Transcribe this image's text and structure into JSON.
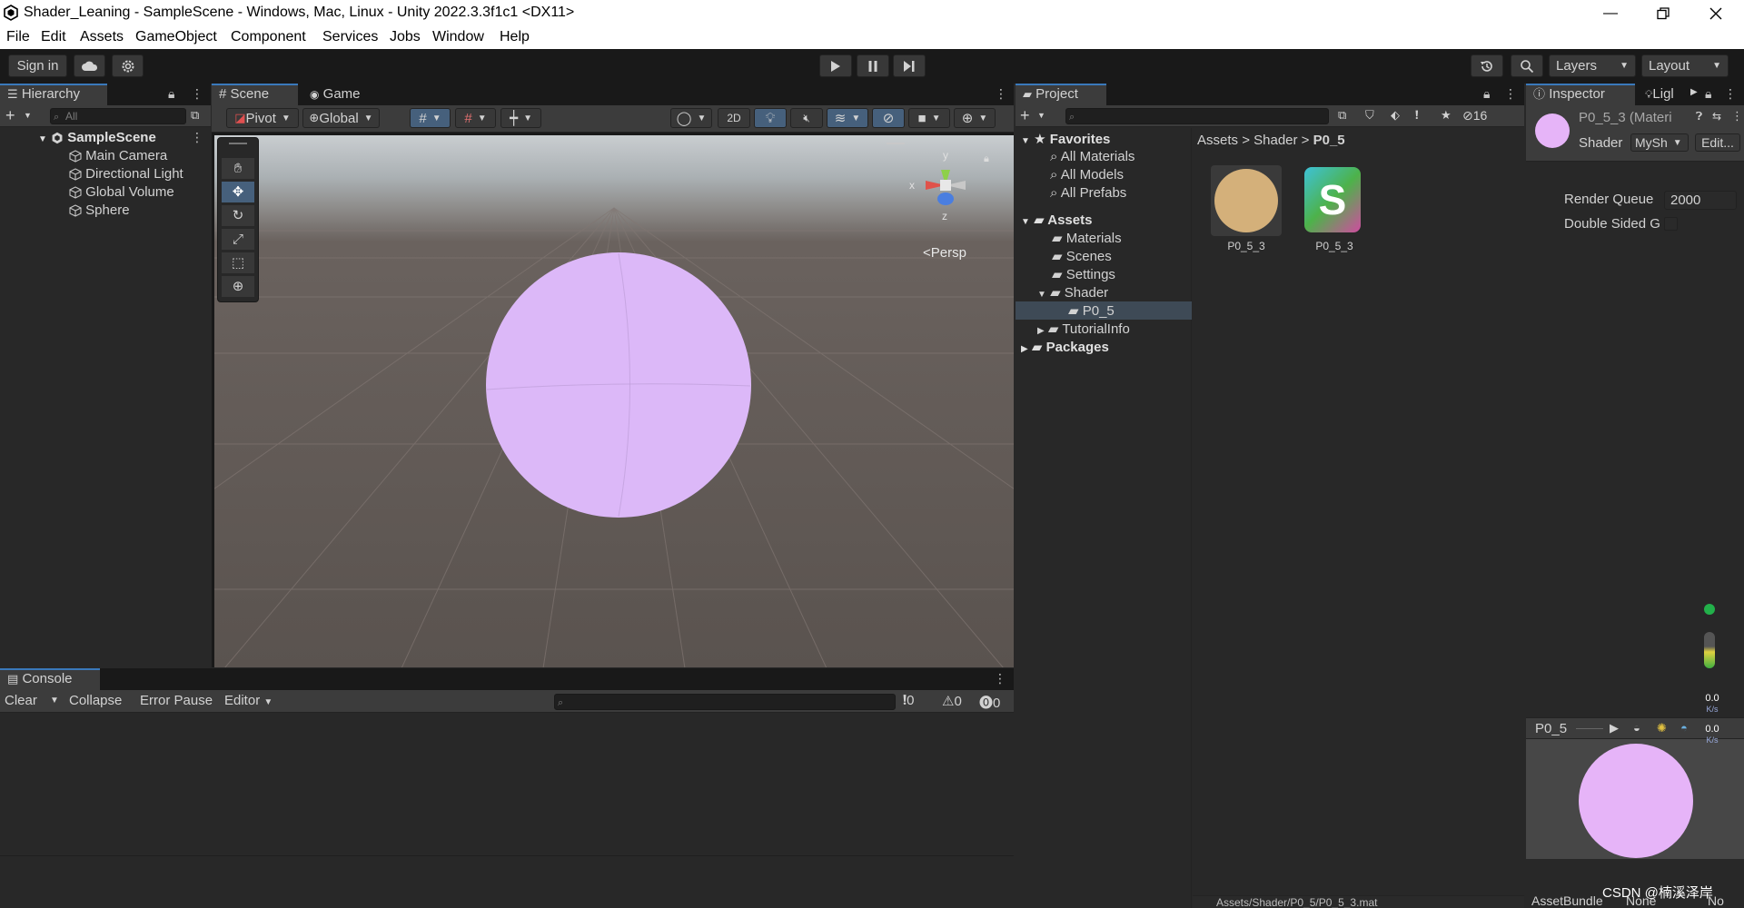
{
  "window": {
    "title": "Shader_Leaning - SampleScene - Windows, Mac, Linux - Unity 2022.3.3f1c1 <DX11>"
  },
  "menu": [
    "File",
    "Edit",
    "Assets",
    "GameObject",
    "Component",
    "Services",
    "Jobs",
    "Window",
    "Help"
  ],
  "toolbar": {
    "sign_in": "Sign in",
    "layers": "Layers",
    "layout": "Layout"
  },
  "hierarchy": {
    "tab": "Hierarchy",
    "search_placeholder": "All",
    "scene": "SampleScene",
    "items": [
      "Main Camera",
      "Directional Light",
      "Global Volume",
      "Sphere"
    ]
  },
  "scene_panel": {
    "tab_scene": "Scene",
    "tab_game": "Game",
    "pivot": "Pivot",
    "global": "Global",
    "mode_2d": "2D",
    "persp": "Persp",
    "axis_x": "x",
    "axis_y": "y",
    "axis_z": "z"
  },
  "console": {
    "tab": "Console",
    "clear": "Clear",
    "collapse": "Collapse",
    "error_pause": "Error Pause",
    "editor": "Editor",
    "count_info": "0",
    "count_warn": "0",
    "count_error": "0"
  },
  "project": {
    "tab": "Project",
    "hidden_count": "16",
    "favorites": "Favorites",
    "fav_items": [
      "All Materials",
      "All Models",
      "All Prefabs"
    ],
    "assets": "Assets",
    "asset_folders": [
      "Materials",
      "Scenes",
      "Settings",
      "Shader"
    ],
    "shader_sub": "P0_5",
    "tutorial": "TutorialInfo",
    "packages": "Packages",
    "breadcrumb": [
      "Assets",
      "Shader",
      "P0_5"
    ],
    "files": [
      {
        "name": "P0_5_3",
        "kind": "material"
      },
      {
        "name": "P0_5_3",
        "kind": "shader",
        "glyph": "S"
      }
    ],
    "footer_path": "Assets/Shader/P0_5/P0_5_3.mat"
  },
  "inspector": {
    "tab": "Inspector",
    "tab_light": "Ligl",
    "object_name": "P0_5_3 (Materi",
    "shader_label": "Shader",
    "shader_value": "MySh",
    "edit_button": "Edit...",
    "render_queue_label": "Render Queue",
    "render_queue_value": "2000",
    "double_sided_label": "Double Sided G",
    "preview_name": "P0_5",
    "assetbundle_label": "AssetBundle",
    "assetbundle_value": "None",
    "assetbundle_variant": "No"
  },
  "overlay": {
    "net_up": "0.0",
    "net_up_unit": "K/s",
    "net_down": "0.0",
    "net_down_unit": "K/s",
    "watermark": "CSDN @楠溪泽岸"
  },
  "colors": {
    "accent": "#3a79bb",
    "sphere": "#dcb8f8",
    "material_swatch": "#d4b07a",
    "preview_sphere": "#e6b4f8"
  }
}
